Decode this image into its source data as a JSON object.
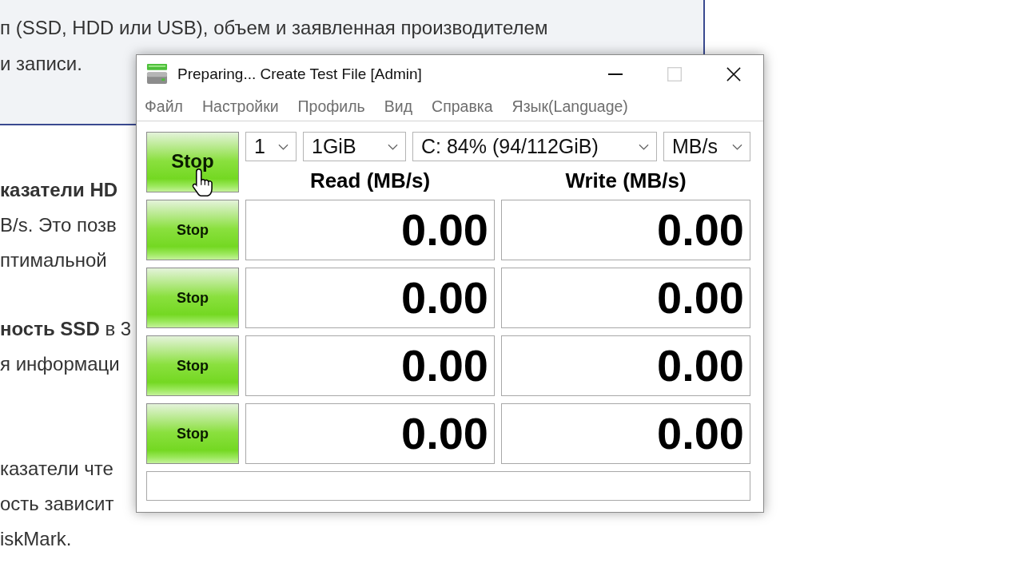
{
  "page": {
    "panel_lines": [
      "п (SSD, HDD или USB), объем и заявленная производителем",
      "и записи."
    ],
    "paragraphs": [
      {
        "lines": [
          "**казатели HD**",
          "B/s. Это позв",
          "птимальной"
        ]
      },
      {
        "lines": [
          "**ность SSD** в 3",
          "я информаци"
        ]
      },
      {
        "lines": [
          "казатели чте",
          "ость зависит",
          "iskMark."
        ]
      }
    ]
  },
  "window": {
    "title": "Preparing... Create Test File [Admin]",
    "controls": [
      {
        "kind": "minimize",
        "disabled": false
      },
      {
        "kind": "maximize",
        "disabled": true
      },
      {
        "kind": "close",
        "disabled": false
      }
    ],
    "menu": [
      {
        "label": "Файл",
        "disabled": true
      },
      {
        "label": "Настройки",
        "disabled": true
      },
      {
        "label": "Профиль",
        "disabled": true
      },
      {
        "label": "Вид",
        "disabled": true
      },
      {
        "label": "Справка",
        "disabled": true
      },
      {
        "label": "Язык(Language)",
        "disabled": true
      }
    ]
  },
  "toolbar": {
    "main_button": "Stop",
    "dropdowns": [
      {
        "value": "1"
      },
      {
        "value": "1GiB"
      },
      {
        "value": "C: 84% (94/112GiB)"
      },
      {
        "value": "MB/s"
      }
    ]
  },
  "columns": [
    "Read (MB/s)",
    "Write (MB/s)"
  ],
  "rows": [
    {
      "button": "Stop",
      "read": "0.00",
      "write": "0.00"
    },
    {
      "button": "Stop",
      "read": "0.00",
      "write": "0.00"
    },
    {
      "button": "Stop",
      "read": "0.00",
      "write": "0.00"
    },
    {
      "button": "Stop",
      "read": "0.00",
      "write": "0.00"
    }
  ]
}
